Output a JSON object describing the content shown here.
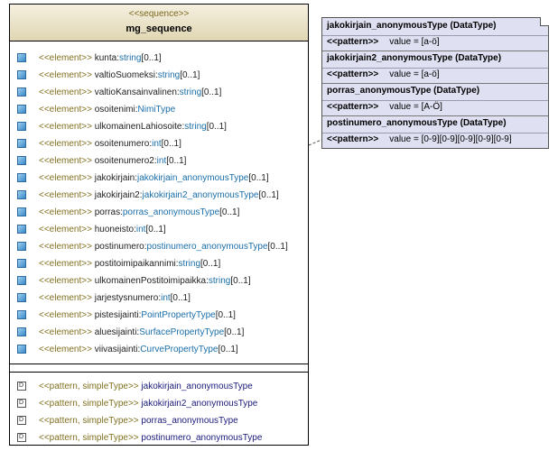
{
  "class": {
    "stereotype": "<<sequence>>",
    "name": "mg_sequence",
    "attributes": [
      {
        "stereo": "<<element>>",
        "name": "kunta",
        "type": "string",
        "mult": "[0..1]"
      },
      {
        "stereo": "<<element>>",
        "name": "valtioSuomeksi",
        "type": "string",
        "mult": "[0..1]"
      },
      {
        "stereo": "<<element>>",
        "name": "valtioKansainvalinen",
        "type": "string",
        "mult": "[0..1]"
      },
      {
        "stereo": "<<element>>",
        "name": "osoitenimi",
        "type": "NimiType",
        "mult": ""
      },
      {
        "stereo": "<<element>>",
        "name": "ulkomainenLahiosoite",
        "type": "string",
        "mult": "[0..1]"
      },
      {
        "stereo": "<<element>>",
        "name": "osoitenumero",
        "type": "int",
        "mult": "[0..1]"
      },
      {
        "stereo": "<<element>>",
        "name": "osoitenumero2",
        "type": "int",
        "mult": "[0..1]"
      },
      {
        "stereo": "<<element>>",
        "name": "jakokirjain",
        "type": "jakokirjain_anonymousType",
        "mult": "[0..1]"
      },
      {
        "stereo": "<<element>>",
        "name": "jakokirjain2",
        "type": "jakokirjain2_anonymousType",
        "mult": "[0..1]"
      },
      {
        "stereo": "<<element>>",
        "name": "porras",
        "type": "porras_anonymousType",
        "mult": "[0..1]"
      },
      {
        "stereo": "<<element>>",
        "name": "huoneisto",
        "type": "int",
        "mult": "[0..1]"
      },
      {
        "stereo": "<<element>>",
        "name": "postinumero",
        "type": "postinumero_anonymousType",
        "mult": "[0..1]"
      },
      {
        "stereo": "<<element>>",
        "name": "postitoimipaikannimi",
        "type": "string",
        "mult": "[0..1]"
      },
      {
        "stereo": "<<element>>",
        "name": "ulkomainenPostitoimipaikka",
        "type": "string",
        "mult": "[0..1]"
      },
      {
        "stereo": "<<element>>",
        "name": "jarjestysnumero",
        "type": "int",
        "mult": "[0..1]"
      },
      {
        "stereo": "<<element>>",
        "name": "pistesijainti",
        "type": "PointPropertyType",
        "mult": "[0..1]"
      },
      {
        "stereo": "<<element>>",
        "name": "aluesijainti",
        "type": "SurfacePropertyType",
        "mult": "[0..1]"
      },
      {
        "stereo": "<<element>>",
        "name": "viivasijainti",
        "type": "CurvePropertyType",
        "mult": "[0..1]"
      }
    ],
    "operations": [
      {
        "stereo": "<<pattern, simpleType>>",
        "name": "jakokirjain_anonymousType"
      },
      {
        "stereo": "<<pattern, simpleType>>",
        "name": "jakokirjain2_anonymousType"
      },
      {
        "stereo": "<<pattern, simpleType>>",
        "name": "porras_anonymousType"
      },
      {
        "stereo": "<<pattern, simpleType>>",
        "name": "postinumero_anonymousType"
      }
    ]
  },
  "note": {
    "entries": [
      {
        "title": "jakokirjain_anonymousType (DataType)",
        "pattern_label": "<<pattern>>",
        "value": "value = [a-ö]"
      },
      {
        "title": "jakokirjain2_anonymousType (DataType)",
        "pattern_label": "<<pattern>>",
        "value": "value = [a-ö]"
      },
      {
        "title": "porras_anonymousType (DataType)",
        "pattern_label": "<<pattern>>",
        "value": "value = [A-Ö]"
      },
      {
        "title": "postinumero_anonymousType (DataType)",
        "pattern_label": "<<pattern>>",
        "value": "value = [0-9][0-9][0-9][0-9][0-9]"
      }
    ]
  },
  "colors": {
    "header_bg": "#e0d6b3",
    "note_bg": "#dfe0f2",
    "stereotype": "#807020",
    "type": "#1a6ea8"
  }
}
